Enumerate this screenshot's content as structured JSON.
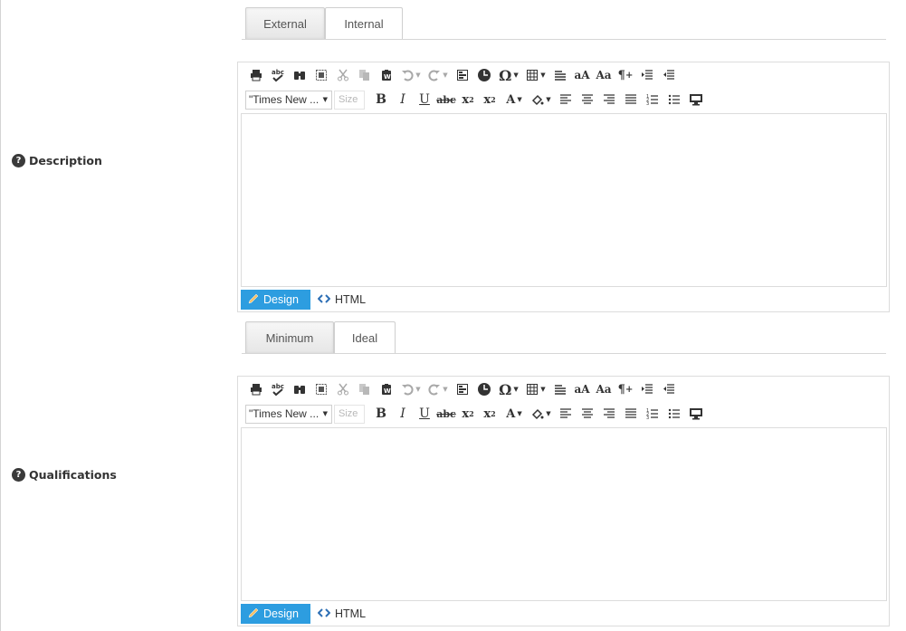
{
  "sections": [
    {
      "label": "Description",
      "help_glyph": "?",
      "tabs": [
        {
          "label": "External",
          "active": true
        },
        {
          "label": "Internal",
          "active": false
        }
      ],
      "font_value": "\"Times New ...",
      "size_placeholder": "Size",
      "modes": {
        "design": "Design",
        "html": "HTML"
      }
    },
    {
      "label": "Qualifications",
      "help_glyph": "?",
      "tabs": [
        {
          "label": "Minimum",
          "active": true
        },
        {
          "label": "Ideal",
          "active": false
        }
      ],
      "font_value": "\"Times New ...",
      "size_placeholder": "Size",
      "modes": {
        "design": "Design",
        "html": "HTML"
      }
    }
  ],
  "toolbar": {
    "row1_icons": [
      "print-icon",
      "spellcheck-icon",
      "find-icon",
      "select-all-icon",
      "cut-icon",
      "copy-icon",
      "paste-word-icon",
      "undo-icon",
      "redo-icon",
      "form-icon",
      "insert-media-icon",
      "special-char-icon",
      "table-icon",
      "paragraph-format-icon",
      "font-size-icon",
      "case-icon",
      "show-paragraph-icon",
      "indent-icon",
      "outdent-icon"
    ],
    "row2_icons": [
      "bold-icon",
      "italic-icon",
      "underline-icon",
      "strikethrough-icon",
      "superscript-icon",
      "subscript-icon",
      "font-color-icon",
      "highlight-icon",
      "align-left-icon",
      "align-center-icon",
      "align-right-icon",
      "justify-icon",
      "ordered-list-icon",
      "unordered-list-icon",
      "fullscreen-icon"
    ]
  },
  "colors": {
    "accent": "#2d9de0",
    "html_icon": "#2d6fb5",
    "label_text": "#333333"
  }
}
